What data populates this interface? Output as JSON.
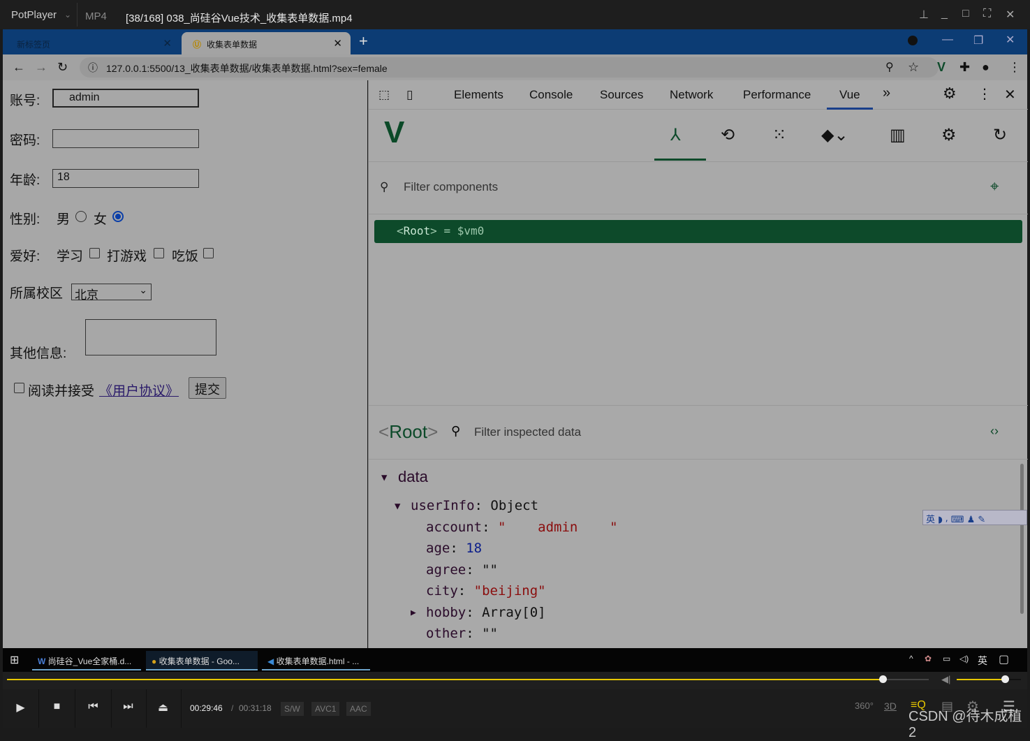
{
  "player": {
    "brand": "PotPlayer",
    "format": "MP4",
    "title": "[38/168] 038_尚硅谷Vue技术_收集表单数据.mp4",
    "time_current": "00:29:46",
    "time_sep": "/",
    "time_total": "00:31:18",
    "badges": [
      "S/W",
      "AVC1",
      "AAC"
    ],
    "progress_percent": 95,
    "volume_percent": 75,
    "extra_icons": [
      "360°",
      "3D"
    ],
    "watermark": "CSDN @待木成植2"
  },
  "browser": {
    "tabs": [
      {
        "label": "新标签页",
        "active": false
      },
      {
        "label": "收集表单数据",
        "active": true
      }
    ],
    "url": "127.0.0.1:5500/13_收集表单数据/收集表单数据.html?sex=female"
  },
  "form": {
    "account_label": "账号:",
    "account_value": "admin",
    "password_label": "密码:",
    "password_value": "",
    "age_label": "年龄:",
    "age_value": "18",
    "sex_label": "性别:",
    "sex_options": [
      {
        "label": "男",
        "checked": false
      },
      {
        "label": "女",
        "checked": true
      }
    ],
    "hobby_label": "爱好:",
    "hobby_options": [
      {
        "label": "学习",
        "checked": false
      },
      {
        "label": "打游戏",
        "checked": false
      },
      {
        "label": "吃饭",
        "checked": false
      }
    ],
    "city_label": "所属校区",
    "city_value": "北京",
    "other_label": "其他信息:",
    "agree_text": "阅读并接受",
    "agree_link": "《用户协议》",
    "submit": "提交"
  },
  "devtools": {
    "tabs": [
      "Elements",
      "Console",
      "Sources",
      "Network",
      "Performance",
      "Vue"
    ],
    "active_tab": "Vue",
    "more": "»",
    "filter_placeholder": "Filter components",
    "root_row": {
      "tag": "Root",
      "suffix": "= $vm0"
    },
    "inspector": {
      "title": "Root",
      "filter_placeholder": "Filter inspected data"
    },
    "data": {
      "section": "data",
      "object_key": "userInfo",
      "object_type": "Object",
      "props": [
        {
          "key": "account",
          "value": "\"    admin    \"",
          "type": "string"
        },
        {
          "key": "age",
          "value": "18",
          "type": "number"
        },
        {
          "key": "agree",
          "value": "\"\"",
          "type": "string"
        },
        {
          "key": "city",
          "value": "\"beijing\"",
          "type": "string"
        },
        {
          "key": "hobby",
          "value": "Array[0]",
          "type": "array"
        },
        {
          "key": "other",
          "value": "\"\"",
          "type": "string"
        }
      ]
    }
  },
  "taskbar": {
    "items": [
      "尚硅谷_Vue全家桶.d...",
      "收集表单数据 - Goo...",
      "收集表单数据.html - ..."
    ],
    "ime": "英"
  },
  "colors": {
    "vue_green": "#0d4a2a",
    "string": "#8a0d0d",
    "number": "#0a1d8a",
    "accent_yellow": "#e8c800"
  }
}
